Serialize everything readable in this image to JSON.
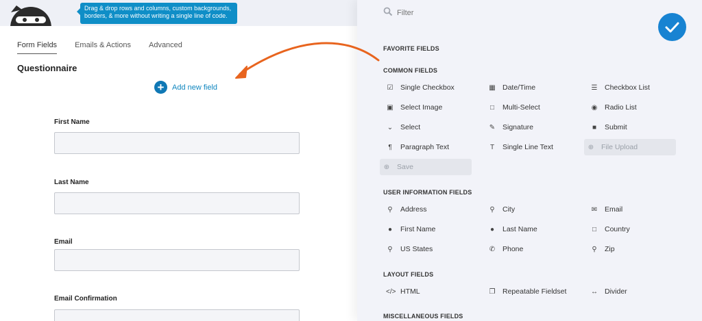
{
  "header": {
    "tooltip_line1": "Drag & drop rows and columns, custom backgrounds,",
    "tooltip_line2": "borders, & more without writing a single line of code."
  },
  "tabs": [
    {
      "label": "Form Fields",
      "active": true
    },
    {
      "label": "Emails & Actions",
      "active": false
    },
    {
      "label": "Advanced",
      "active": false
    }
  ],
  "form": {
    "title": "Questionnaire",
    "add_field_label": "Add new field",
    "fields": [
      {
        "label": "First Name",
        "value": ""
      },
      {
        "label": "Last Name",
        "value": ""
      },
      {
        "label": "Email",
        "value": ""
      },
      {
        "label": "Email Confirmation",
        "value": ""
      }
    ]
  },
  "drawer": {
    "filter_placeholder": "Filter",
    "confirm_icon": "check-icon",
    "sections": {
      "favorite": "FAVORITE FIELDS",
      "common": "COMMON FIELDS",
      "user_info": "USER INFORMATION FIELDS",
      "layout": "LAYOUT FIELDS",
      "misc": "MISCELLANEOUS FIELDS"
    },
    "common_items": [
      {
        "label": "Single Checkbox",
        "icon": "checkbox-icon",
        "disabled": false
      },
      {
        "label": "Date/Time",
        "icon": "calendar-icon",
        "disabled": false
      },
      {
        "label": "Checkbox List",
        "icon": "list-icon",
        "disabled": false
      },
      {
        "label": "Select Image",
        "icon": "image-icon",
        "disabled": false
      },
      {
        "label": "Multi-Select",
        "icon": "square-icon",
        "disabled": false
      },
      {
        "label": "Radio List",
        "icon": "radio-icon",
        "disabled": false
      },
      {
        "label": "Select",
        "icon": "chevron-down-icon",
        "disabled": false
      },
      {
        "label": "Signature",
        "icon": "pen-icon",
        "disabled": false
      },
      {
        "label": "Submit",
        "icon": "filled-square-icon",
        "disabled": false
      },
      {
        "label": "Paragraph Text",
        "icon": "paragraph-icon",
        "disabled": false
      },
      {
        "label": "Single Line Text",
        "icon": "text-icon",
        "disabled": false
      },
      {
        "label": "File Upload",
        "icon": "upload-icon",
        "disabled": true
      },
      {
        "label": "Save",
        "icon": "plus-circle-icon",
        "disabled": true
      }
    ],
    "user_items": [
      {
        "label": "Address",
        "icon": "map-marker-icon"
      },
      {
        "label": "City",
        "icon": "map-marker-icon"
      },
      {
        "label": "Email",
        "icon": "envelope-icon"
      },
      {
        "label": "First Name",
        "icon": "user-icon"
      },
      {
        "label": "Last Name",
        "icon": "user-icon"
      },
      {
        "label": "Country",
        "icon": "square-icon"
      },
      {
        "label": "US States",
        "icon": "map-marker-icon"
      },
      {
        "label": "Phone",
        "icon": "phone-icon"
      },
      {
        "label": "Zip",
        "icon": "map-marker-icon"
      }
    ],
    "layout_items": [
      {
        "label": "HTML",
        "icon": "code-icon"
      },
      {
        "label": "Repeatable Fieldset",
        "icon": "copy-icon"
      },
      {
        "label": "Divider",
        "icon": "arrows-h-icon"
      }
    ]
  },
  "colors": {
    "accent": "#0f8ec7",
    "confirm": "#1883d2",
    "arrow": "#e8641e"
  }
}
